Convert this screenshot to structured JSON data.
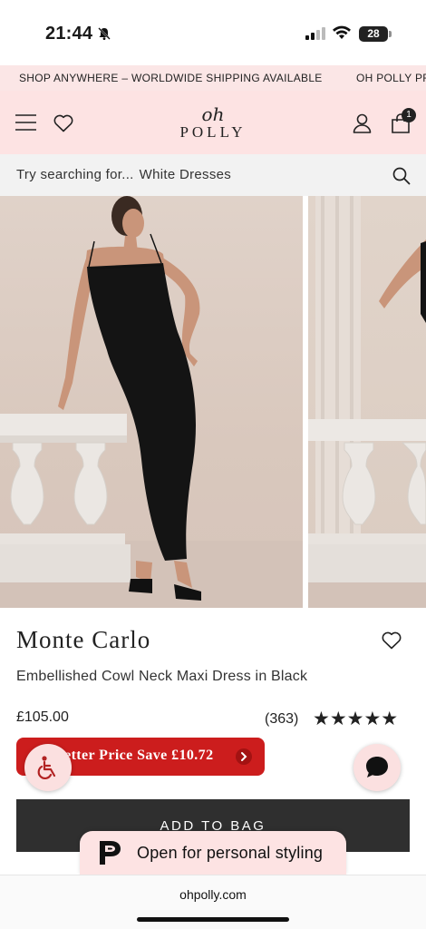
{
  "status_bar": {
    "time": "21:44",
    "battery": "28"
  },
  "promo": {
    "message_1": "SHOP ANYWHERE – WORLDWIDE SHIPPING AVAILABLE",
    "message_2": "OH POLLY PR"
  },
  "header": {
    "logo_top": "oh",
    "logo_bottom": "POLLY",
    "cart_count": "1"
  },
  "search": {
    "prefix": "Try searching for...",
    "suggestion": "White Dresses"
  },
  "product": {
    "name": "Monte Carlo",
    "description": "Embellished Cowl Neck Maxi Dress in Black",
    "price": "£105.00",
    "review_count": "(363)",
    "stars": "★★★★★",
    "rating": 5,
    "better_price_label": "Better Price Save £10.72"
  },
  "actions": {
    "add_to_bag": "ADD TO BAG",
    "personal_styling": "Open for personal styling"
  },
  "browser": {
    "url": "ohpolly.com"
  },
  "colors": {
    "brand_pink": "#fde3e3",
    "promo_red": "#cc1d1d",
    "button_dark": "#2f2f2f"
  }
}
